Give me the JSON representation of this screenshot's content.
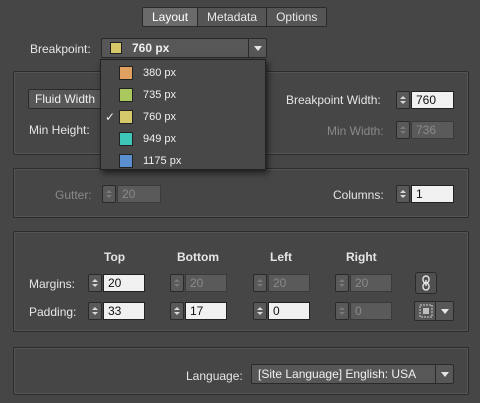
{
  "tabs": [
    "Layout",
    "Metadata",
    "Options"
  ],
  "breakpoint": {
    "label": "Breakpoint:",
    "selected": "760 px",
    "selected_color": "#d5c96a",
    "options": [
      {
        "label": "380 px",
        "color": "#e0a060"
      },
      {
        "label": "735 px",
        "color": "#a9c95e"
      },
      {
        "label": "760 px",
        "color": "#d5c96a",
        "checked": true
      },
      {
        "label": "949 px",
        "color": "#3cc7b6"
      },
      {
        "label": "1175 px",
        "color": "#5a90d0"
      }
    ]
  },
  "layout": {
    "fluid_width_label": "Fluid Width",
    "min_height_label": "Min Height:",
    "breakpoint_width_label": "Breakpoint Width:",
    "breakpoint_width_value": "760",
    "min_width_label": "Min Width:",
    "min_width_value": "736"
  },
  "grid": {
    "gutter_label": "Gutter:",
    "gutter_value": "20",
    "columns_label": "Columns:",
    "columns_value": "1"
  },
  "spacing": {
    "col_headers": [
      "Top",
      "Bottom",
      "Left",
      "Right"
    ],
    "margins_label": "Margins:",
    "margins": [
      "20",
      "20",
      "20",
      "20"
    ],
    "padding_label": "Padding:",
    "padding": [
      "33",
      "17",
      "0",
      "0"
    ]
  },
  "language": {
    "label": "Language:",
    "value": "[Site Language] English: USA"
  },
  "icons": {
    "link": "link-icon",
    "stepper": "stepper-icon",
    "dropdown": "chevron-down-icon"
  }
}
